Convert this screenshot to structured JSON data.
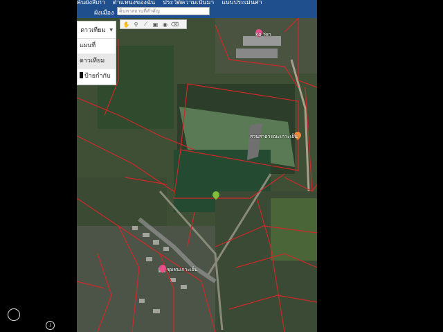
{
  "topbar": {
    "items": [
      "คันผังสีเก่า",
      "ตำแหน่งของฉัน",
      "ประวัติความเป็นมา",
      "แบบประเมินศา"
    ]
  },
  "search": {
    "label": "ผังเมือง",
    "placeholder": "ค้นหาสถานที่สำคัญ"
  },
  "layers": {
    "current": "ดาวเทียม",
    "options": [
      {
        "label": "แผนที่",
        "selected": false
      },
      {
        "label": "ดาวเทียม",
        "selected": true
      },
      {
        "label": "ป้ายกำกับ",
        "checked": true
      }
    ]
  },
  "toolbar": {
    "tools": [
      "hand-icon",
      "pin-icon",
      "line-icon",
      "polygon-icon",
      "circle-icon",
      "clear-icon"
    ]
  },
  "map": {
    "pois": [
      {
        "name": "Ko Yen",
        "color": "#e84f8a"
      },
      {
        "name": "สวนสาธารณะเกาะเย็น",
        "color": "#f08a3c"
      },
      {
        "name": "",
        "color": "#7fbf3a"
      },
      {
        "name": "ชุมชนเกาะเย็น",
        "color": "#e84f8a"
      }
    ]
  },
  "colors": {
    "header": "#1f4f8c",
    "parcel_lines": "#d02828"
  }
}
